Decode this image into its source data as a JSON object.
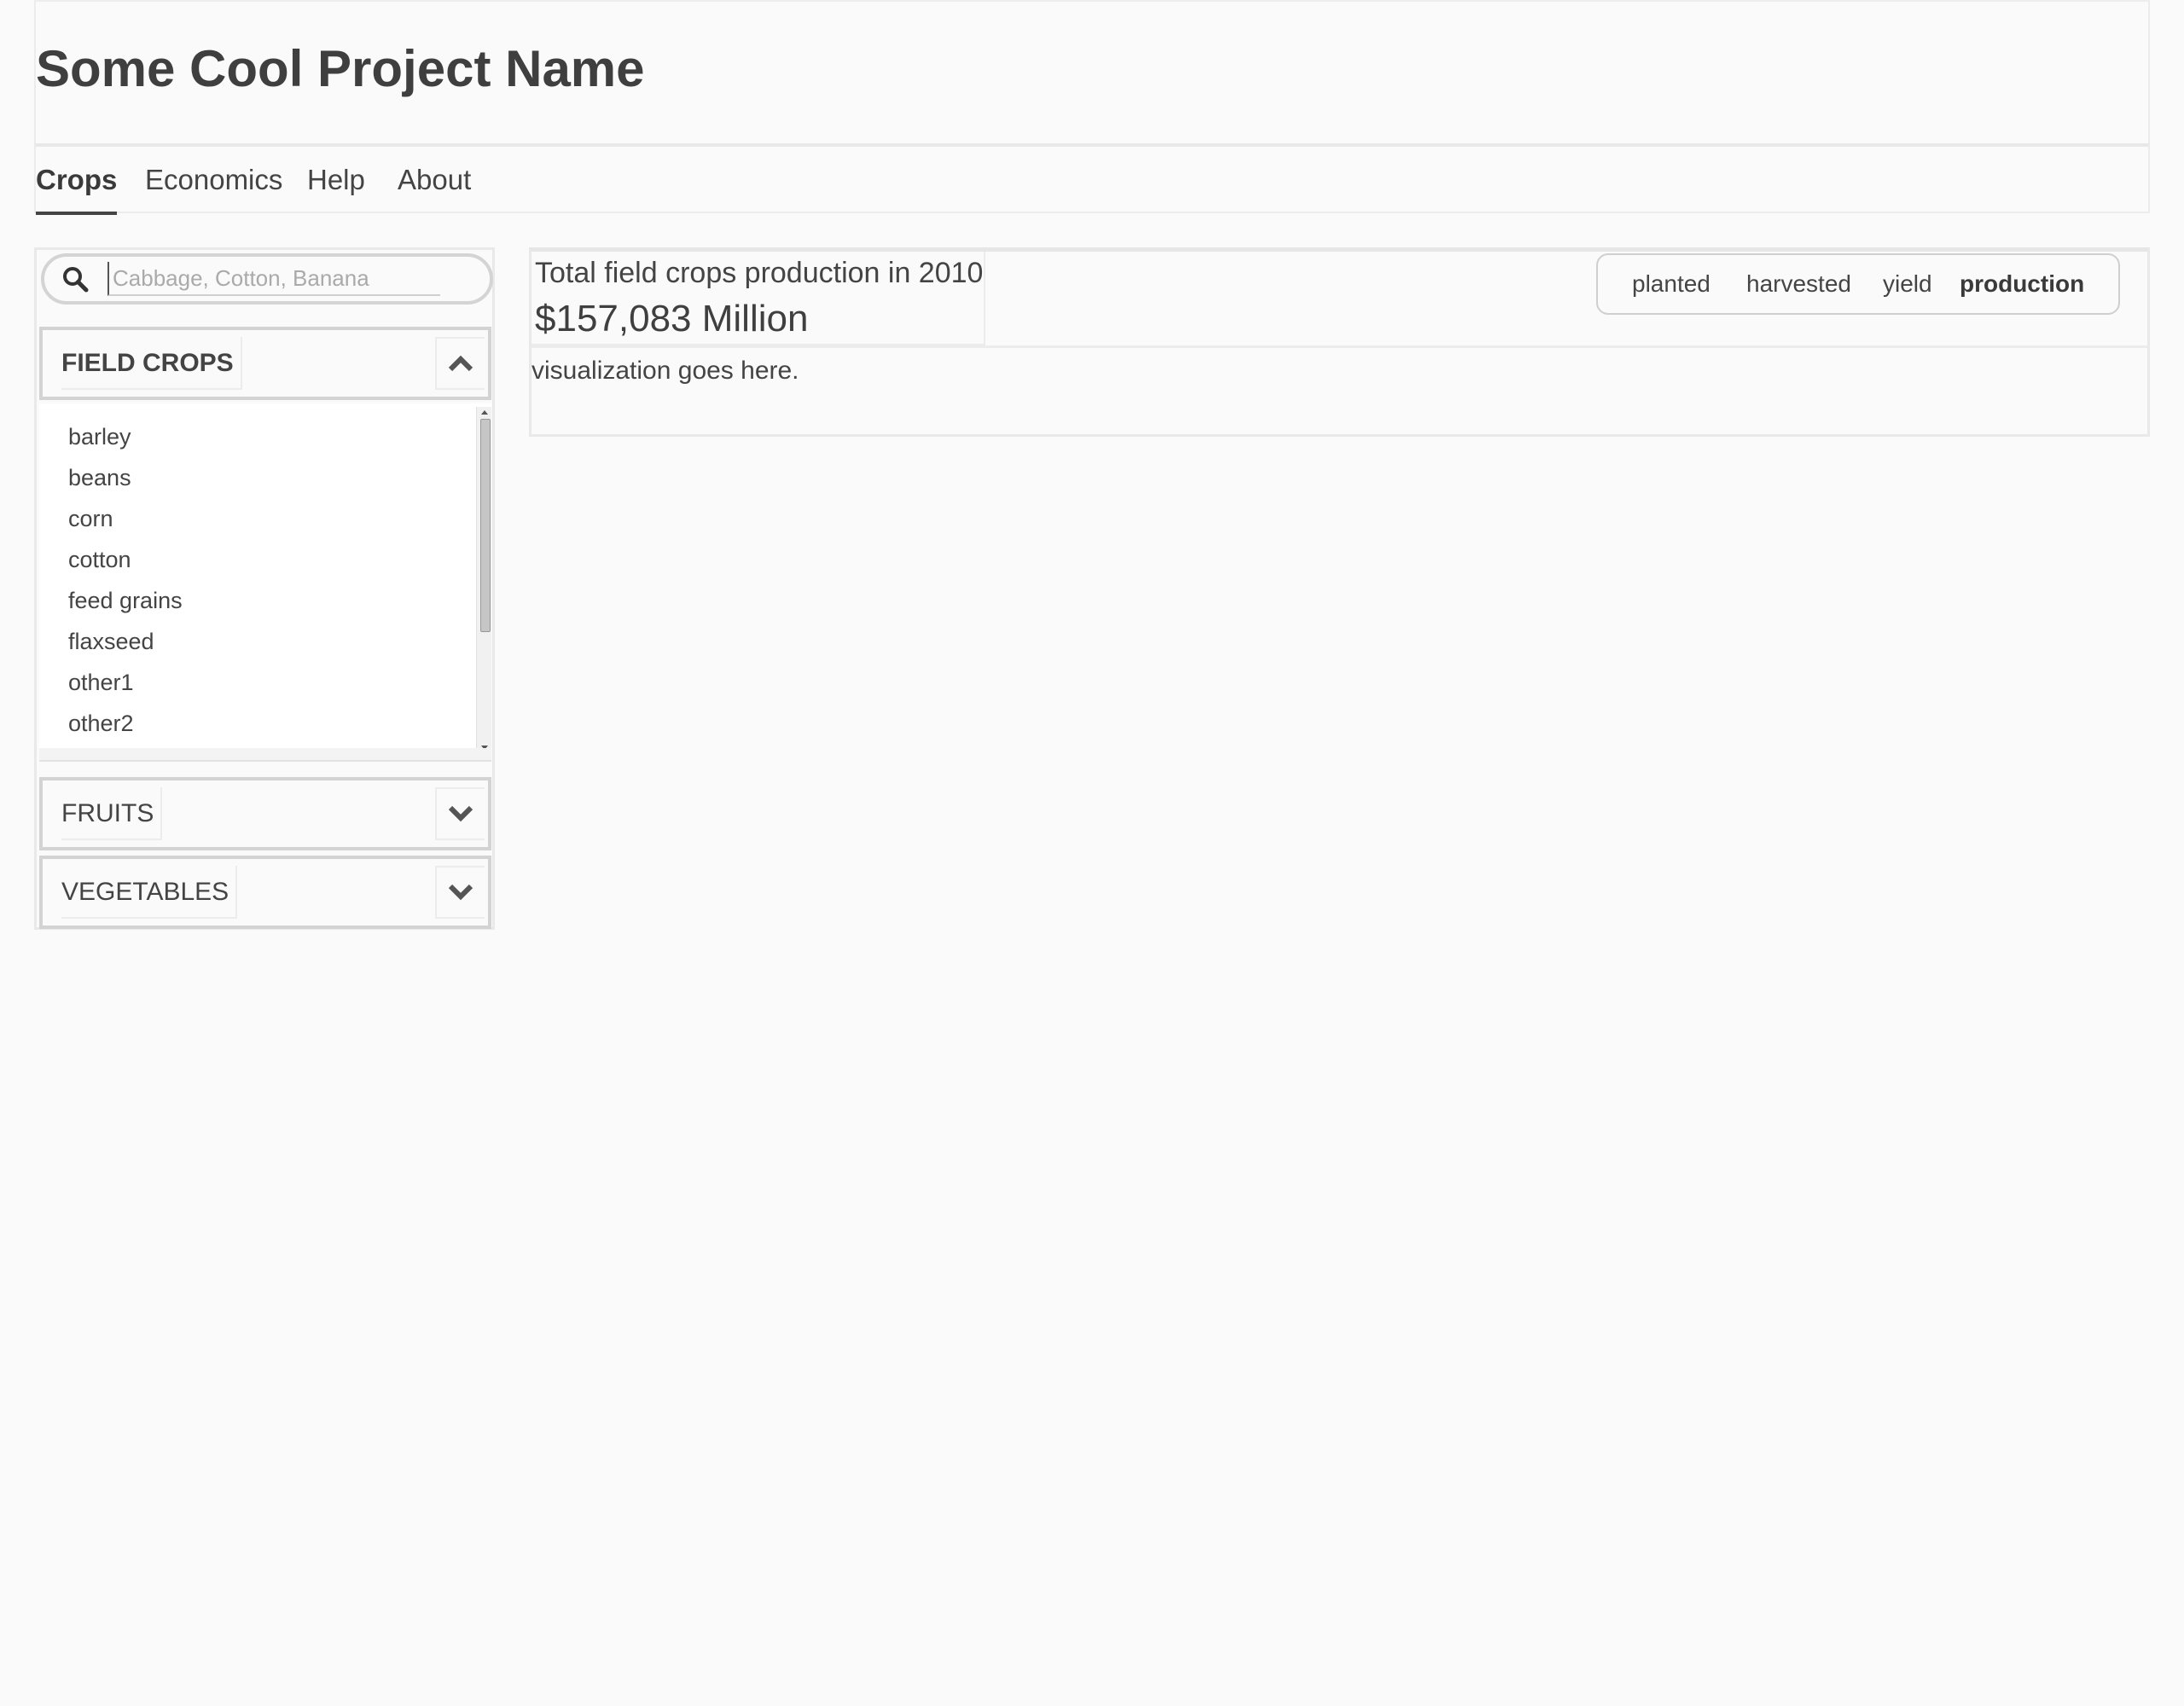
{
  "app": {
    "title": "Some Cool Project Name"
  },
  "nav": {
    "tabs": [
      {
        "label": "Crops",
        "active": true
      },
      {
        "label": "Economics",
        "active": false
      },
      {
        "label": "Help",
        "active": false
      },
      {
        "label": "About",
        "active": false
      }
    ]
  },
  "sidebar": {
    "search": {
      "placeholder": "Cabbage, Cotton, Banana",
      "value": "",
      "icon": "search-icon"
    },
    "sections": [
      {
        "label": "FIELD CROPS",
        "expanded": true,
        "toggle_icon": "chevron-up-icon",
        "items": [
          "barley",
          "beans",
          "corn",
          "cotton",
          "feed grains",
          "flaxseed",
          "other1",
          "other2"
        ]
      },
      {
        "label": "FRUITS",
        "expanded": false,
        "toggle_icon": "chevron-down-icon"
      },
      {
        "label": "VEGETABLES",
        "expanded": false,
        "toggle_icon": "chevron-down-icon"
      }
    ]
  },
  "main": {
    "stat": {
      "label": "Total field crops production in 2010",
      "value": "$157,083 Million"
    },
    "metric_toggle": {
      "options": [
        {
          "label": "planted",
          "active": false
        },
        {
          "label": "harvested",
          "active": false
        },
        {
          "label": "yield",
          "active": false
        },
        {
          "label": "production",
          "active": true
        }
      ]
    },
    "visualization_text": "visualization goes here."
  }
}
